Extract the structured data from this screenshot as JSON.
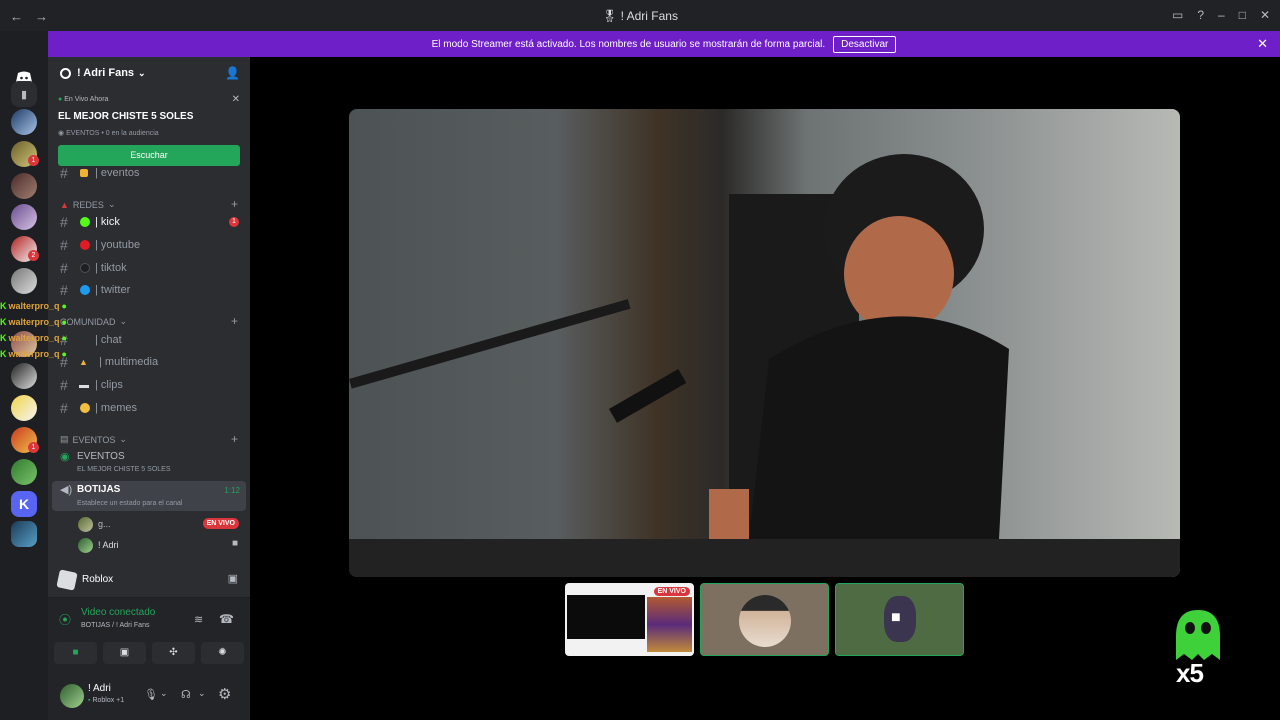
{
  "window": {
    "title": "! Adri Fans"
  },
  "banner": {
    "text": "El modo Streamer está activado. Los nombres de usuario se mostrarán de forma parcial.",
    "button": "Desactivar"
  },
  "server": {
    "name": "! Adri Fans"
  },
  "live_card": {
    "label": "En Vivo Ahora",
    "title": "EL MEJOR CHISTE 5 SOLES",
    "meta": "EVENTOS • 0 en la audiencia",
    "button": "Escuchar"
  },
  "channels": {
    "eventos_top": "| eventos",
    "cat_redes": "REDES",
    "redes": [
      {
        "label": "| kick",
        "color": "#53fc18",
        "badge": "1",
        "active": true
      },
      {
        "label": "| youtube",
        "color": "#e01b24"
      },
      {
        "label": "| tiktok",
        "color": "#2b2d31"
      },
      {
        "label": "| twitter",
        "color": "#1d9bf0"
      }
    ],
    "cat_comunidad": "COMUNIDAD",
    "comunidad": [
      {
        "label": "| chat",
        "icon": "speech-icon"
      },
      {
        "label": "| multimedia",
        "icon": "fire-icon"
      },
      {
        "label": "| clips",
        "icon": "camera-icon"
      },
      {
        "label": "| memes",
        "icon": "smile-icon"
      }
    ],
    "cat_eventos": "EVENTOS",
    "eventos_stage": {
      "label": "EVENTOS",
      "sub": "EL MEJOR CHISTE 5 SOLES"
    },
    "voice": {
      "label": "BOTIJAS",
      "time": "1:12",
      "status": "Establece un estado para el canal"
    },
    "users": [
      {
        "name": "g...",
        "badge": "EN VIVO"
      },
      {
        "name": "! Adri"
      }
    ]
  },
  "overlay_chat": [
    "walterpro_q",
    "walterpro_q",
    "walterpro_q",
    "walterpro_q"
  ],
  "activity": {
    "name": "Roblox"
  },
  "voice_status": {
    "title": "Video conectado",
    "sub": "BOTIJAS / ! Adri Fans"
  },
  "user_panel": {
    "name": "! Adri",
    "status": "Roblox +1"
  },
  "thumbnails": [
    {
      "badge": "EN VIVO"
    },
    {},
    {}
  ],
  "mascot": {
    "text": "x5"
  },
  "colors": {
    "accent": "#6e1fc7",
    "green": "#23a55a",
    "red": "#da373c"
  }
}
